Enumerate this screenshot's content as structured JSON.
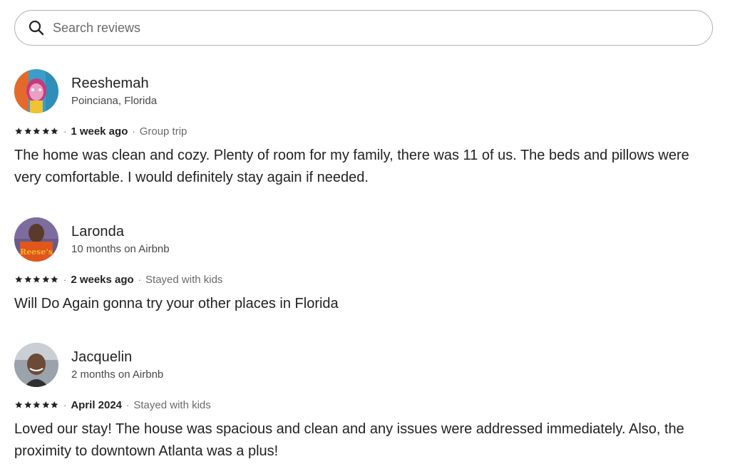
{
  "search": {
    "placeholder": "Search reviews",
    "icon": "search-icon"
  },
  "reviews": [
    {
      "name": "Reeshemah",
      "subtitle": "Poinciana, Florida",
      "rating": 5,
      "date": "1 week ago",
      "trip_type": "Group trip",
      "text": "The home was clean and cozy. Plenty of room for my family, there was 11 of us. The beds and pillows were very comfortable. I would definitely stay again if needed.",
      "avatar_colors": [
        "#3b9ec9",
        "#e46a2c",
        "#c73a7a",
        "#f1c232"
      ]
    },
    {
      "name": "Laronda",
      "subtitle": "10 months on Airbnb",
      "rating": 5,
      "date": "2 weeks ago",
      "trip_type": "Stayed with kids",
      "text": "Will Do Again gonna try your other places in Florida",
      "avatar_colors": [
        "#6a5a8a",
        "#e0561b",
        "#5a3a2a",
        "#f3b233"
      ]
    },
    {
      "name": "Jacquelin",
      "subtitle": "2 months on Airbnb",
      "rating": 5,
      "date": "April 2024",
      "trip_type": "Stayed with kids",
      "text": "Loved our stay! The house was spacious and clean and any issues were addressed immediately. Also, the proximity to downtown Atlanta was a plus!",
      "avatar_colors": [
        "#9aa3ab",
        "#6b4a38",
        "#2f2f33",
        "#c9cfd4"
      ]
    }
  ],
  "colors": {
    "text_primary": "#222222",
    "text_secondary": "#6a6a6a",
    "border": "#b0b0b0"
  },
  "star_icon": "star-icon"
}
